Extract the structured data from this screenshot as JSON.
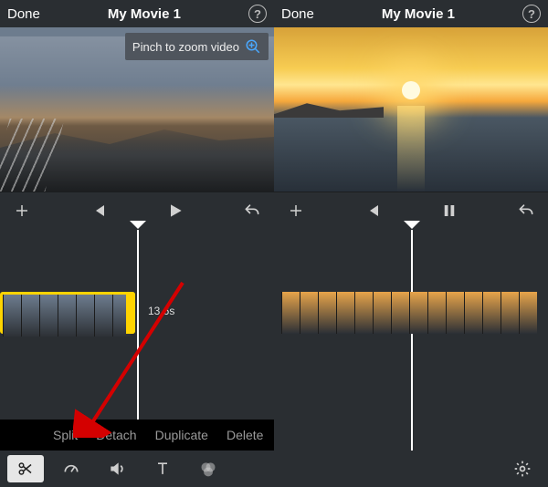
{
  "left": {
    "topbar": {
      "done": "Done",
      "title": "My Movie 1",
      "help": "?"
    },
    "preview_hint": "Pinch to zoom video",
    "timeline": {
      "duration_label": "13.6s"
    },
    "actions": {
      "split": "Split",
      "detach": "Detach",
      "duplicate": "Duplicate",
      "delete": "Delete"
    }
  },
  "right": {
    "topbar": {
      "done": "Done",
      "title": "My Movie 1",
      "help": "?"
    }
  }
}
